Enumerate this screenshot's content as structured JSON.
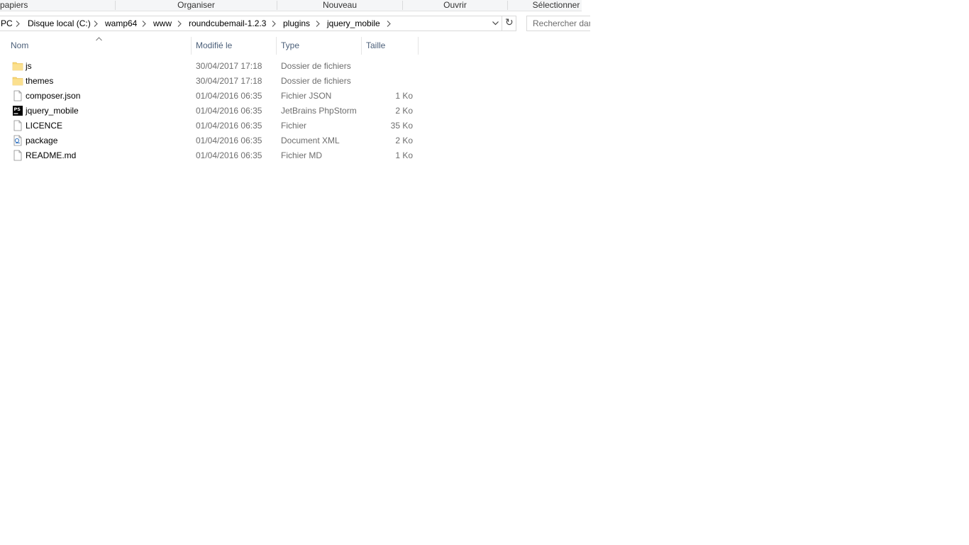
{
  "ribbon": {
    "groups": [
      "papiers",
      "Organiser",
      "Nouveau",
      "Ouvrir",
      "Sélectionner"
    ]
  },
  "address_bar": {
    "breadcrumbs": [
      "PC",
      "Disque local (C:)",
      "wamp64",
      "www",
      "roundcubemail-1.2.3",
      "plugins",
      "jquery_mobile"
    ],
    "dropdown_icon": "chevron-down-icon",
    "refresh_icon": "refresh-icon"
  },
  "search": {
    "placeholder": "Rechercher dans : jquery_mobile"
  },
  "columns": {
    "name": "Nom",
    "modified": "Modifié le",
    "type": "Type",
    "size": "Taille",
    "sorted_by": "name",
    "sort_direction": "ascending"
  },
  "files": [
    {
      "name": "js",
      "modified": "30/04/2017 17:18",
      "type": "Dossier de fichiers",
      "size": "",
      "icon": "folder-icon"
    },
    {
      "name": "themes",
      "modified": "30/04/2017 17:18",
      "type": "Dossier de fichiers",
      "size": "",
      "icon": "folder-icon"
    },
    {
      "name": "composer.json",
      "modified": "01/04/2016 06:35",
      "type": "Fichier JSON",
      "size": "1 Ko",
      "icon": "file-icon"
    },
    {
      "name": "jquery_mobile",
      "modified": "01/04/2016 06:35",
      "type": "JetBrains PhpStorm",
      "size": "2 Ko",
      "icon": "phpstorm-icon"
    },
    {
      "name": "LICENCE",
      "modified": "01/04/2016 06:35",
      "type": "Fichier",
      "size": "35 Ko",
      "icon": "file-icon"
    },
    {
      "name": "package",
      "modified": "01/04/2016 06:35",
      "type": "Document XML",
      "size": "2 Ko",
      "icon": "xml-file-icon"
    },
    {
      "name": "README.md",
      "modified": "01/04/2016 06:35",
      "type": "Fichier MD",
      "size": "1 Ko",
      "icon": "file-icon"
    }
  ],
  "colors": {
    "header_text": "#4c607a",
    "secondary_text": "#6d6d6d",
    "folder": "#f8d775"
  }
}
